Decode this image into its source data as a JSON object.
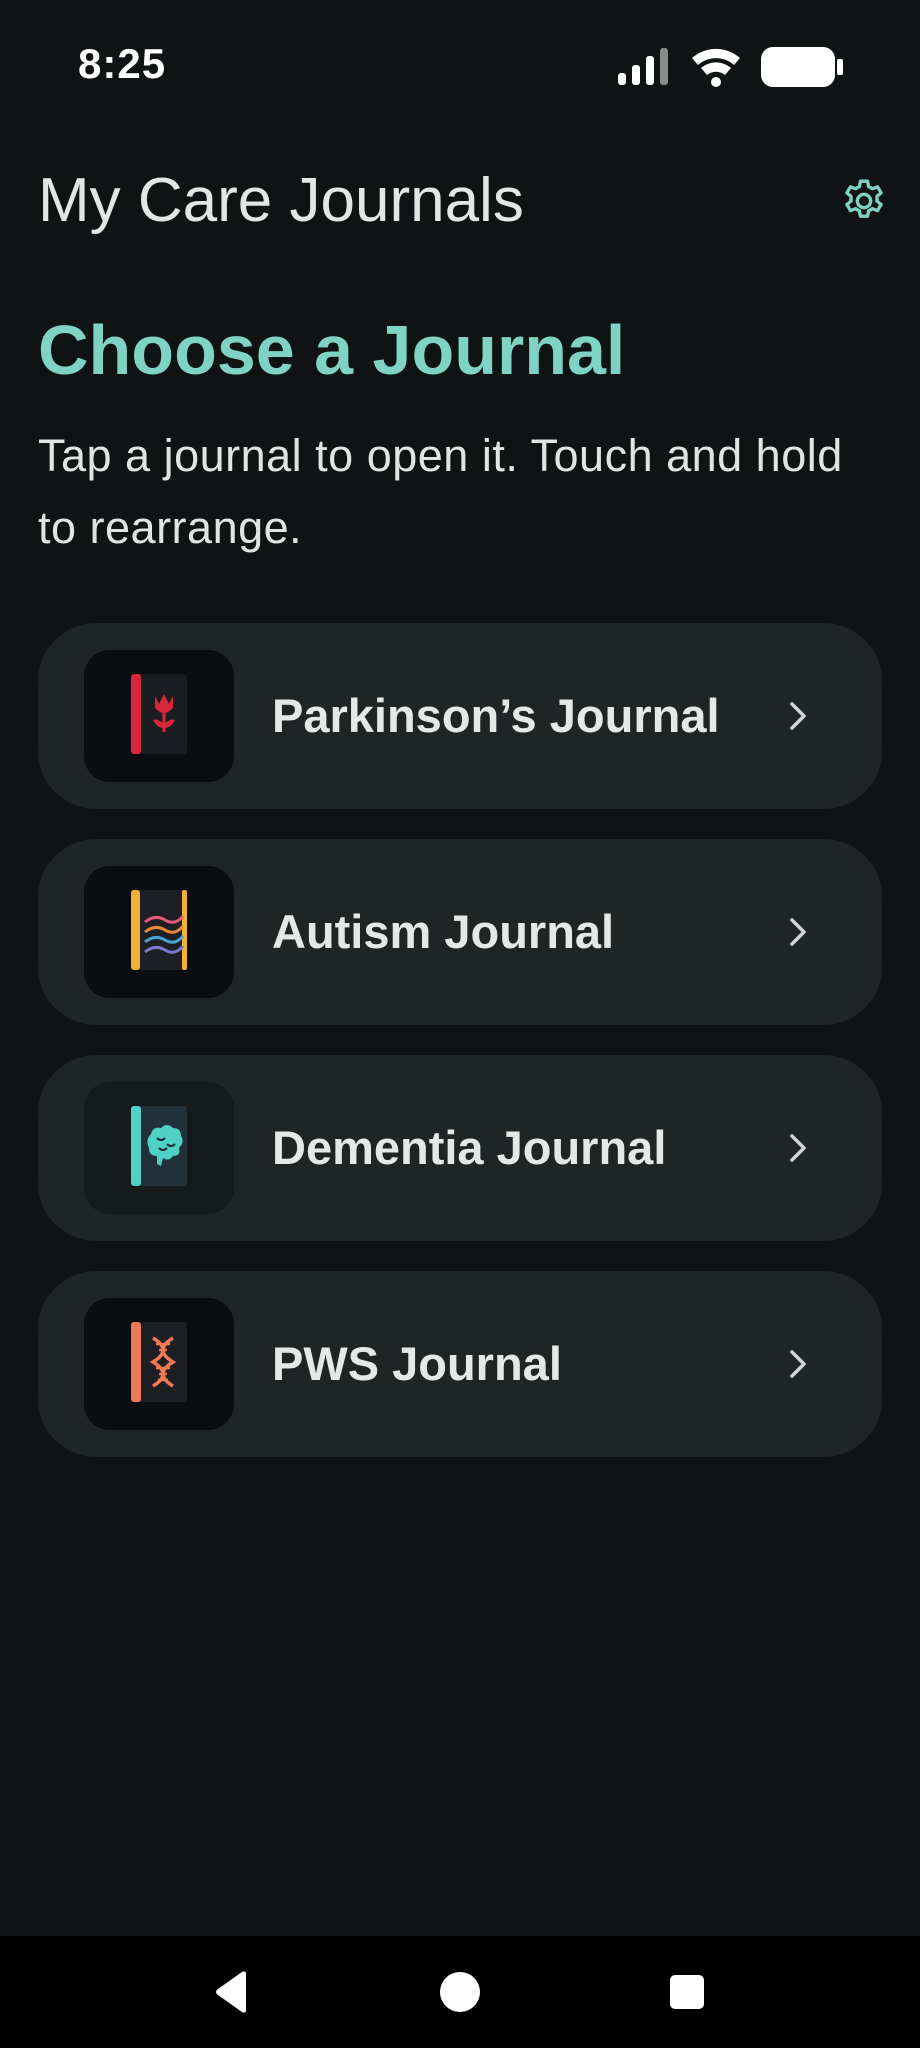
{
  "status_bar": {
    "time": "8:25",
    "icons": [
      "signal-icon",
      "wifi-icon",
      "battery-icon"
    ]
  },
  "header": {
    "title": "My Care Journals",
    "settings_icon": "gear-icon"
  },
  "main": {
    "heading": "Choose a Journal",
    "instructions": "Tap a journal to open it. Touch and hold to rearrange."
  },
  "journals": [
    {
      "label": "Parkinson’s Journal",
      "icon": "tulip-book-icon",
      "accent": "#d8263a"
    },
    {
      "label": "Autism Journal",
      "icon": "wave-book-icon",
      "accent": "#f2b234"
    },
    {
      "label": "Dementia Journal",
      "icon": "brain-book-icon",
      "accent": "#4fd1c5"
    },
    {
      "label": "PWS Journal",
      "icon": "dna-book-icon",
      "accent": "#f07a55"
    }
  ],
  "nav": {
    "back_icon": "back-triangle-icon",
    "home_icon": "home-circle-icon",
    "recents_icon": "recents-square-icon"
  },
  "colors": {
    "background": "#0f1314",
    "card": "#1f2424",
    "accent": "#7fd3c4"
  }
}
